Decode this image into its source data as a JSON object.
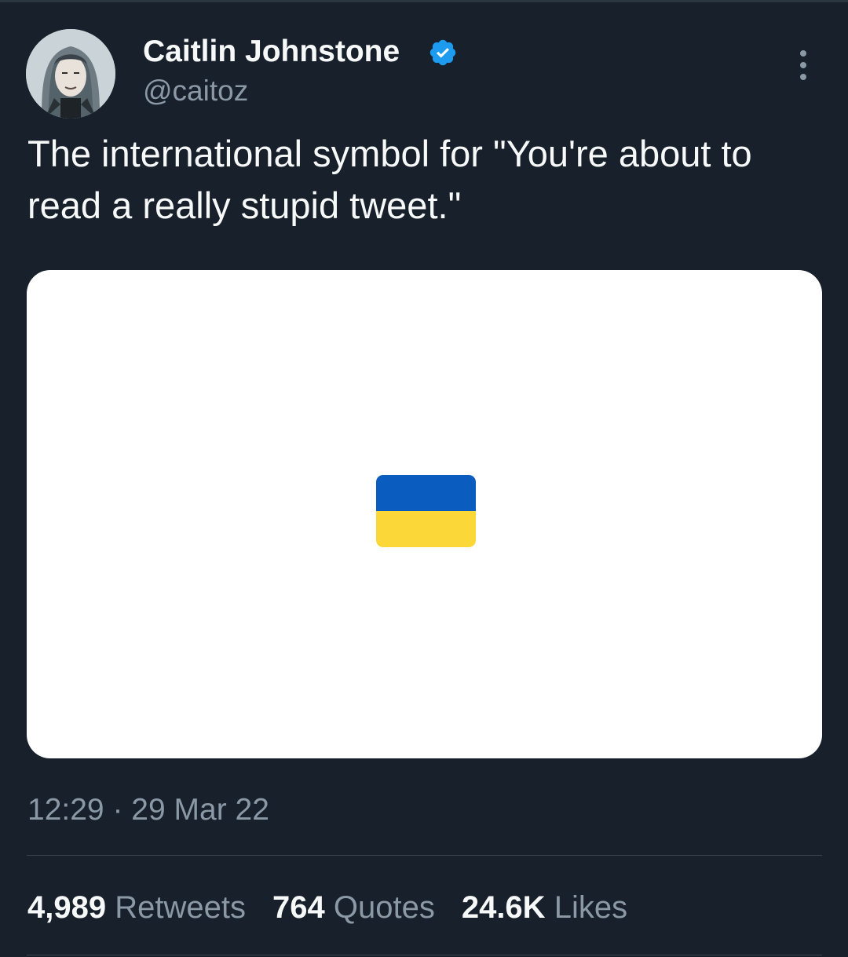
{
  "user": {
    "display_name": "Caitlin Johnstone",
    "handle": "@caitoz",
    "verified": true
  },
  "tweet": {
    "text": "The international symbol for \"You're about to read a really stupid tweet.\"",
    "media": {
      "kind": "image",
      "content": "ukraine-flag-emoji",
      "colors": {
        "top": "#0a5cbe",
        "bottom": "#fbd737",
        "background": "#ffffff"
      }
    },
    "time": "12:29",
    "separator": "·",
    "date": "29 Mar 22"
  },
  "stats": {
    "retweets": {
      "count": "4,989",
      "label": "Retweets"
    },
    "quotes": {
      "count": "764",
      "label": "Quotes"
    },
    "likes": {
      "count": "24.6K",
      "label": "Likes"
    }
  },
  "icons": {
    "verified": "verified-badge-icon",
    "more": "more-options-icon"
  },
  "colors": {
    "background": "#17202b",
    "text_primary": "#f7f9f9",
    "text_secondary": "#8b98a5",
    "verified_blue": "#1d9bf0",
    "divider": "#38444d"
  }
}
